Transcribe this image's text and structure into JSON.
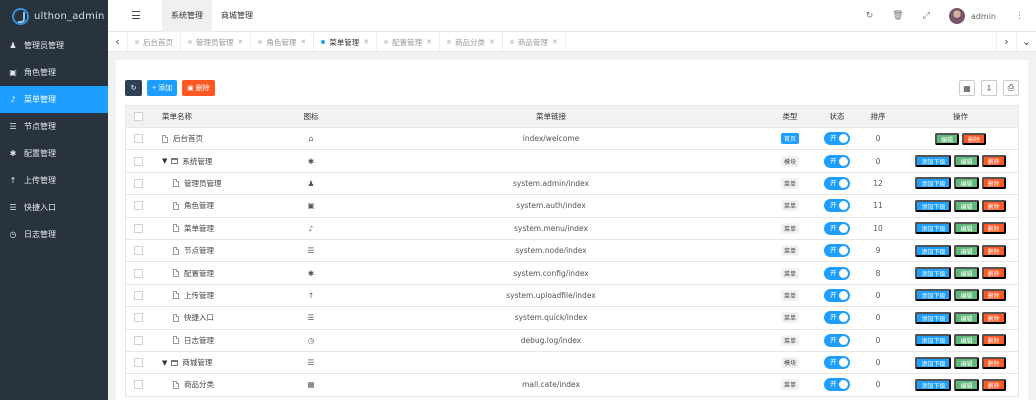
{
  "sidebar": {
    "logo_text": "ulthon_admin",
    "items": [
      {
        "label": "管理员管理",
        "icon": "user-icon"
      },
      {
        "label": "角色管理",
        "icon": "id-card-icon"
      },
      {
        "label": "菜单管理",
        "icon": "bell-icon",
        "active": true
      },
      {
        "label": "节点管理",
        "icon": "list-icon"
      },
      {
        "label": "配置管理",
        "icon": "gear-icon"
      },
      {
        "label": "上传管理",
        "icon": "upload-icon"
      },
      {
        "label": "快捷入口",
        "icon": "list-icon"
      },
      {
        "label": "日志管理",
        "icon": "clock-icon"
      }
    ]
  },
  "header": {
    "top_nav": [
      {
        "label": "系统管理",
        "active": true
      },
      {
        "label": "商城管理",
        "active": false
      }
    ],
    "username": "admin"
  },
  "tabs": [
    {
      "label": "后台首页",
      "active": false,
      "closable": false
    },
    {
      "label": "管理员管理",
      "active": false,
      "closable": true
    },
    {
      "label": "角色管理",
      "active": false,
      "closable": true
    },
    {
      "label": "菜单管理",
      "active": true,
      "closable": true
    },
    {
      "label": "配置管理",
      "active": false,
      "closable": true
    },
    {
      "label": "商品分类",
      "active": false,
      "closable": true
    },
    {
      "label": "商品管理",
      "active": false,
      "closable": true
    }
  ],
  "toolbar": {
    "add_label": "添加",
    "delete_label": "删除"
  },
  "table": {
    "headers": {
      "name": "菜单名称",
      "icon": "图标",
      "href": "菜单链接",
      "type": "类型",
      "status": "状态",
      "sort": "排序",
      "actions": "操作"
    },
    "rows": [
      {
        "name": "后台首页",
        "level": 0,
        "folder": false,
        "icon": "home-icon",
        "href": "index/welcome",
        "type": "首页",
        "status": "开",
        "sort": "0",
        "actions": [
          "编辑",
          "删除"
        ]
      },
      {
        "name": "系统管理",
        "level": 0,
        "folder": true,
        "icon": "gear-icon",
        "href": "",
        "type": "模块",
        "status": "开",
        "sort": "0",
        "actions": [
          "添加下级",
          "编辑",
          "删除"
        ]
      },
      {
        "name": "管理员管理",
        "level": 1,
        "folder": false,
        "icon": "user-icon",
        "href": "system.admin/index",
        "type": "菜单",
        "status": "开",
        "sort": "12",
        "actions": [
          "添加下级",
          "编辑",
          "删除"
        ]
      },
      {
        "name": "角色管理",
        "level": 1,
        "folder": false,
        "icon": "id-card-icon",
        "href": "system.auth/index",
        "type": "菜单",
        "status": "开",
        "sort": "11",
        "actions": [
          "添加下级",
          "编辑",
          "删除"
        ]
      },
      {
        "name": "菜单管理",
        "level": 1,
        "folder": false,
        "icon": "bell-icon",
        "href": "system.menu/index",
        "type": "菜单",
        "status": "开",
        "sort": "10",
        "actions": [
          "添加下级",
          "编辑",
          "删除"
        ]
      },
      {
        "name": "节点管理",
        "level": 1,
        "folder": false,
        "icon": "list-icon",
        "href": "system.node/index",
        "type": "菜单",
        "status": "开",
        "sort": "9",
        "actions": [
          "添加下级",
          "编辑",
          "删除"
        ]
      },
      {
        "name": "配置管理",
        "level": 1,
        "folder": false,
        "icon": "gear-icon",
        "href": "system.config/index",
        "type": "菜单",
        "status": "开",
        "sort": "8",
        "actions": [
          "添加下级",
          "编辑",
          "删除"
        ]
      },
      {
        "name": "上传管理",
        "level": 1,
        "folder": false,
        "icon": "upload-icon",
        "href": "system.uploadfile/index",
        "type": "菜单",
        "status": "开",
        "sort": "0",
        "actions": [
          "添加下级",
          "编辑",
          "删除"
        ]
      },
      {
        "name": "快捷入口",
        "level": 1,
        "folder": false,
        "icon": "list-icon",
        "href": "system.quick/index",
        "type": "菜单",
        "status": "开",
        "sort": "0",
        "actions": [
          "添加下级",
          "编辑",
          "删除"
        ]
      },
      {
        "name": "日志管理",
        "level": 1,
        "folder": false,
        "icon": "clock-icon",
        "href": "debug.log/index",
        "type": "菜单",
        "status": "开",
        "sort": "0",
        "actions": [
          "添加下级",
          "编辑",
          "删除"
        ]
      },
      {
        "name": "商城管理",
        "level": 0,
        "folder": true,
        "icon": "list-icon",
        "href": "",
        "type": "模块",
        "status": "开",
        "sort": "0",
        "actions": [
          "添加下级",
          "编辑",
          "删除"
        ]
      },
      {
        "name": "商品分类",
        "level": 1,
        "folder": false,
        "icon": "calendar-icon",
        "href": "mall.cate/index",
        "type": "菜单",
        "status": "开",
        "sort": "0",
        "actions": [
          "添加下级",
          "编辑",
          "删除"
        ]
      }
    ]
  },
  "colors": {
    "sidebar": "#28333e",
    "accent": "#1e9fff",
    "danger": "#ff5722",
    "success": "#5fb878"
  }
}
